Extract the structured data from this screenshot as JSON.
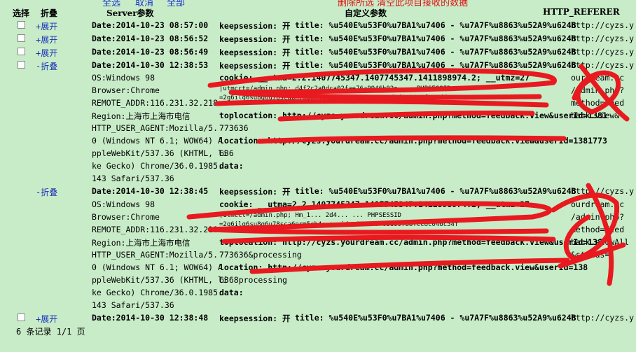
{
  "top_links": {
    "select_all": "全选",
    "deselect": "取消",
    "all": "全部"
  },
  "red_note": "删除所选     清空此项目接收的数据",
  "headers": {
    "select": "选择",
    "fold": "折叠",
    "server_params": "Server参数",
    "custom_params": "自定义参数",
    "referer": "HTTP_REFERER"
  },
  "rows": [
    {
      "fold": "+展开",
      "date": "Date:2014-10-23 08:57:00",
      "keep": "keepsession: 开",
      "title": "title: %u540E%u53F0%u7BA1%u7406 - %u7A7F%u8863%u52A9%u624B",
      "ref": "http://cyzs.y"
    },
    {
      "fold": "+展开",
      "date": "Date:2014-10-23 08:56:52",
      "keep": "keepsession: 开",
      "title": "title: %u540E%u53F0%u7BA1%u7406 - %u7A7F%u8863%u52A9%u624B",
      "ref": "http://cyzs.y"
    },
    {
      "fold": "+展开",
      "date": "Date:2014-10-23 08:56:49",
      "keep": "keepsession: 开",
      "title": "title: %u540E%u53F0%u7BA1%u7406 - %u7A7F%u8863%u52A9%u624B",
      "ref": "http://cyzs.y"
    },
    {
      "fold": "-折叠",
      "date": "Date:2014-10-30 12:38:53",
      "keep": "keepsession: 开",
      "title": "title: %u540E%u53F0%u7BA1%u7406 - %u7A7F%u8863%u52A9%u624B",
      "ref": "http://cyzs.y"
    }
  ],
  "exp1": {
    "left": [
      "OS:Windows 98",
      "Browser:Chrome",
      "REMOTE_ADDR:116.231.32.218",
      "Region:上海市上海市电信",
      "HTTP_USER_AGENT:Mozilla/5.",
      "0 (Windows NT 6.1; WOW64) A",
      "ppleWebKit/537.36 (KHTML, li",
      "ke Gecko) Chrome/36.0.1985.",
      "143 Safari/537.36"
    ],
    "cookie": "cookie: __utma=2.2.1407745347.1407745347.1411898974.2; __utmz=27",
    "cookie2": "|utmcct=/admin.php; d4f2c2a0dca02fae76a9946b02e ... PHPSESSID",
    "cookie3": "=2g6ilq6su8g6u78sca6nrm5ch4; amvid=d3285  ...  d5d2e84e6fc90dd5",
    "toplocation": "toplocation: http://cyzs.yourdream.cc/admin.php?method=feedback.view&userId=1381",
    "toplocation2": "773636",
    "location": "location: http://cyzs.yourdream.cc/admin.php?method=feedback.view&userId=1381773",
    "location2": "636",
    "data": "data:",
    "ref_lines": [
      "ourdream.cc",
      "/admin.php?",
      "method=feed",
      "back.view&"
    ]
  },
  "row2": {
    "fold": "-折叠",
    "date": "Date:2014-10-30 12:38:45",
    "keep": "keepsession: 开",
    "title": "title: %u540E%u53F0%u7BA1%u7406 - %u7A7F%u8863%u52A9%u624B",
    "ref": "http://cyzs.y"
  },
  "exp2": {
    "left": [
      "OS:Windows 98",
      "Browser:Chrome",
      "REMOTE_ADDR:116.231.32.218",
      "Region:上海市上海市电信",
      "HTTP_USER_AGENT:Mozilla/5.",
      "0 (Windows NT 6.1; WOW64) A",
      "ppleWebKit/537.36 (KHTML, li",
      "ke Gecko) Chrome/36.0.1985.",
      "143 Safari/537.36"
    ],
    "cookie": "cookie: __utma=2.2.1407745347.1407745347.1411898974.2; __utmz=27",
    "cookie2": "|utmcct=/admin.php; Hm_1... 2d4... ... PHPSESSID",
    "cookie3": "=2g6ilq6su8g6u78sca6nrm5ch4; amvid=e691... 08699788fcc8c046c54f",
    "toplocation": "toplocation: http://cyzs.yourdream.cc/admin.php?method=feedback.view&userId=138",
    "toplocation2": "773636&processing",
    "location": "location: http://cyzs.yourdream.cc/admin.php?method=feedback.view&userId=138",
    "location2": "6368processing",
    "data": "data:",
    "ref_lines": [
      "ourdream.cc",
      "/admin.php?",
      "method=feed",
      "back.showAll",
      "&status="
    ]
  },
  "row_last": {
    "fold": "+展开",
    "date": "Date:2014-10-30 12:38:48",
    "keep": "keepsession: 开",
    "title": "title: %u540E%u53F0%u7BA1%u7406 - %u7A7F%u8863%u52A9%u624B",
    "ref": "http://cyzs.y"
  },
  "footer": "6 条记录 1/1 页"
}
